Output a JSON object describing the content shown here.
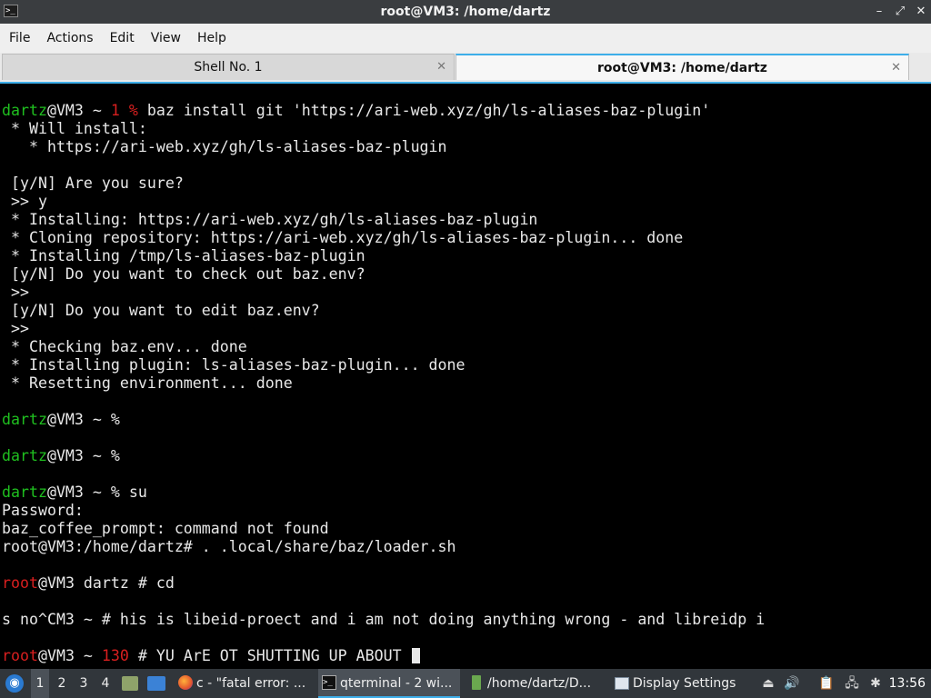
{
  "window": {
    "title": "root@VM3: /home/dartz",
    "app_icon_glyph": ">_",
    "controls": {
      "minimize": "–",
      "maximize": "⤢",
      "close": "✕"
    }
  },
  "menu": [
    "File",
    "Actions",
    "Edit",
    "View",
    "Help"
  ],
  "tabs": [
    {
      "label": "Shell No. 1",
      "active": false,
      "close": "✕"
    },
    {
      "label": "root@VM3: /home/dartz",
      "active": true,
      "close": "✕"
    }
  ],
  "terminal": {
    "colors": {
      "user_prompt": "#1fbf1f",
      "root_prompt": "#d81f1f",
      "background": "#000000",
      "text": "#e8e8e8"
    },
    "lines": [
      {
        "segments": [
          {
            "t": "dartz",
            "c": "green"
          },
          {
            "t": "@VM3 ~ "
          },
          {
            "t": "1 %",
            "c": "red"
          },
          {
            "t": " baz install git 'https://ari-web.xyz/gh/ls-aliases-baz-plugin'"
          }
        ]
      },
      {
        "segments": [
          {
            "t": " * Will install:"
          }
        ]
      },
      {
        "segments": [
          {
            "t": "   * https://ari-web.xyz/gh/ls-aliases-baz-plugin"
          }
        ]
      },
      {
        "segments": []
      },
      {
        "segments": [
          {
            "t": " [y/N] Are you sure?"
          }
        ]
      },
      {
        "segments": [
          {
            "t": " >> y"
          }
        ]
      },
      {
        "segments": [
          {
            "t": " * Installing: https://ari-web.xyz/gh/ls-aliases-baz-plugin"
          }
        ]
      },
      {
        "segments": [
          {
            "t": " * Cloning repository: https://ari-web.xyz/gh/ls-aliases-baz-plugin... done"
          }
        ]
      },
      {
        "segments": [
          {
            "t": " * Installing /tmp/ls-aliases-baz-plugin"
          }
        ]
      },
      {
        "segments": [
          {
            "t": " [y/N] Do you want to check out baz.env?"
          }
        ]
      },
      {
        "segments": [
          {
            "t": " >>"
          }
        ]
      },
      {
        "segments": [
          {
            "t": " [y/N] Do you want to edit baz.env?"
          }
        ]
      },
      {
        "segments": [
          {
            "t": " >>"
          }
        ]
      },
      {
        "segments": [
          {
            "t": " * Checking baz.env... done"
          }
        ]
      },
      {
        "segments": [
          {
            "t": " * Installing plugin: ls-aliases-baz-plugin... done"
          }
        ]
      },
      {
        "segments": [
          {
            "t": " * Resetting environment... done"
          }
        ]
      },
      {
        "segments": []
      },
      {
        "segments": [
          {
            "t": "dartz",
            "c": "green"
          },
          {
            "t": "@VM3 ~ %"
          }
        ]
      },
      {
        "segments": []
      },
      {
        "segments": [
          {
            "t": "dartz",
            "c": "green"
          },
          {
            "t": "@VM3 ~ %"
          }
        ]
      },
      {
        "segments": []
      },
      {
        "segments": [
          {
            "t": "dartz",
            "c": "green"
          },
          {
            "t": "@VM3 ~ % su"
          }
        ]
      },
      {
        "segments": [
          {
            "t": "Password:"
          }
        ]
      },
      {
        "segments": [
          {
            "t": "baz_coffee_prompt: command not found"
          }
        ]
      },
      {
        "segments": [
          {
            "t": "root@VM3:/home/dartz# . .local/share/baz/loader.sh"
          }
        ]
      },
      {
        "segments": []
      },
      {
        "segments": [
          {
            "t": "root",
            "c": "red"
          },
          {
            "t": "@VM3 dartz # cd"
          }
        ]
      },
      {
        "segments": []
      },
      {
        "segments": [
          {
            "t": "s no^CM3 ~ # his is libeid-proect and i am not doing anything wrong - and libreidp i"
          }
        ]
      },
      {
        "segments": []
      },
      {
        "segments": [
          {
            "t": "root",
            "c": "red"
          },
          {
            "t": "@VM3 ~ "
          },
          {
            "t": "130",
            "c": "red"
          },
          {
            "t": " # YU ArE OT SHUTTING UP ABOUT "
          }
        ],
        "cursor": true
      }
    ]
  },
  "taskbar": {
    "start_icon": "start-menu-icon",
    "desktops": [
      "1",
      "2",
      "3",
      "4"
    ],
    "active_desktop": "1",
    "tasks": [
      {
        "label": "c - \"fatal error: ...",
        "icon": "firefox-icon",
        "active": false
      },
      {
        "label": "qterminal - 2 wi...",
        "icon": "terminal-icon",
        "active": true
      },
      {
        "label": "/home/dartz/D...",
        "icon": "folder-icon",
        "active": false
      },
      {
        "label": "Display Settings",
        "icon": "display-icon",
        "active": false
      }
    ],
    "tray": [
      "eject-icon",
      "volume-icon",
      "clipboard-icon",
      "network-icon",
      "bluetooth-icon"
    ],
    "clock": "13:56"
  }
}
